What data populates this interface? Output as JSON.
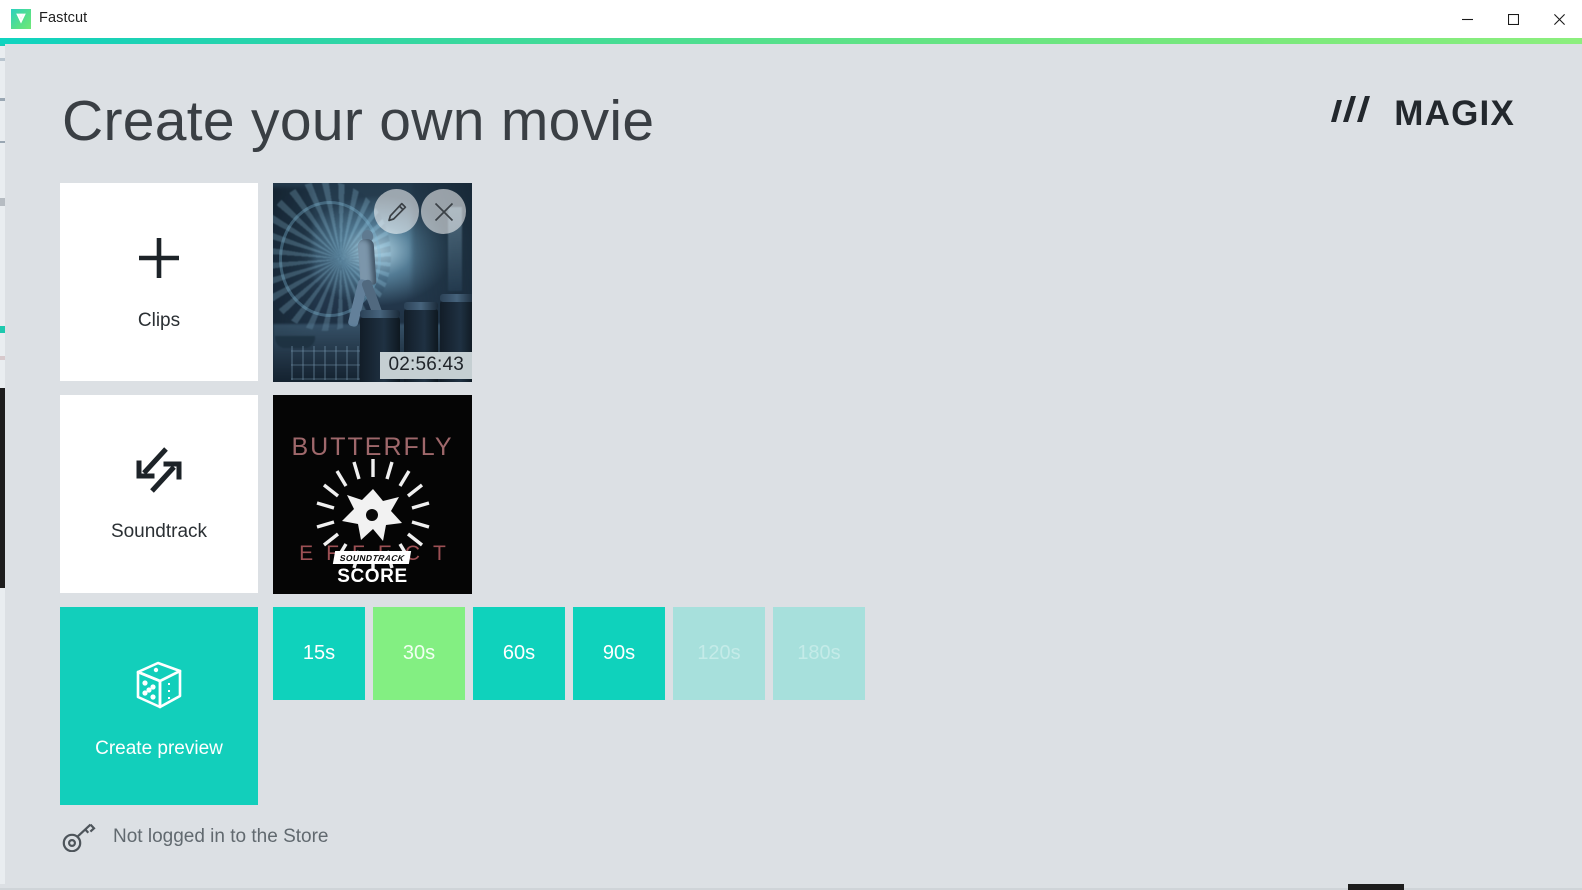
{
  "window": {
    "title": "Fastcut",
    "app_icon": "fastcut-v-logo",
    "controls": {
      "minimize": "minimize-icon",
      "maximize": "maximize-icon",
      "close": "close-icon"
    },
    "accent_gradient_from": "#0fd4c0",
    "accent_gradient_to": "#8cef7e"
  },
  "header": {
    "title": "Create your own movie",
    "brand": "MAGIX",
    "brand_mark": "three-slashes-icon"
  },
  "tiles": {
    "clips": {
      "label": "Clips",
      "icon": "plus-icon"
    },
    "soundtrack": {
      "label": "Soundtrack",
      "icon": "swap-arrows-icon"
    },
    "create_preview": {
      "label": "Create preview",
      "icon": "dice-icon",
      "color": "#12cfbb"
    }
  },
  "clip_thumbnail": {
    "duration": "02:56:43",
    "edit_icon": "pencil-icon",
    "remove_icon": "close-icon"
  },
  "soundtrack_thumbnail": {
    "title": "BUTTERFLY",
    "subtitle": "EFFECT",
    "badge_sound": "SOUND",
    "badge_track": "TRACK",
    "badge_score": "SCORE",
    "artwork": "radial-burst-artwork"
  },
  "durations": [
    {
      "label": "15s",
      "state": "normal",
      "color": "#0fd2bc"
    },
    {
      "label": "30s",
      "state": "selected",
      "color": "#83ef82"
    },
    {
      "label": "60s",
      "state": "normal",
      "color": "#0fd2bc"
    },
    {
      "label": "90s",
      "state": "normal",
      "color": "#0fd2bc"
    },
    {
      "label": "120s",
      "state": "disabled",
      "color": "#a7e0dc"
    },
    {
      "label": "180s",
      "state": "disabled",
      "color": "#a7e0dc"
    }
  ],
  "status": {
    "text": "Not logged in to the Store",
    "icon": "key-icon"
  },
  "theme": {
    "background": "#dce0e4",
    "tile_background": "#ffffff",
    "accent": "#12cfbb",
    "text": "#3a3f44"
  }
}
